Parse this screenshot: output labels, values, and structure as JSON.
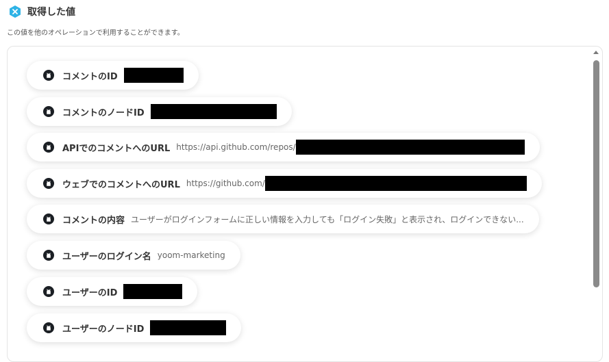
{
  "header": {
    "title": "取得した値",
    "description": "この値を他のオペレーションで利用することができます。"
  },
  "fields": [
    {
      "label": "コメントのID",
      "value": ""
    },
    {
      "label": "コメントのノードID",
      "value": ""
    },
    {
      "label": "APIでのコメントへのURL",
      "value": "https://api.github.com/repos/"
    },
    {
      "label": "ウェブでのコメントへのURL",
      "value": "https://github.com/"
    },
    {
      "label": "コメントの内容",
      "value": "ユーザーがログインフォームに正しい情報を入力しても「ログイン失敗」と表示され、ログインできない..."
    },
    {
      "label": "ユーザーのログイン名",
      "value": "yoom-marketing"
    },
    {
      "label": "ユーザーのID",
      "value": ""
    },
    {
      "label": "ユーザーのノードID",
      "value": ""
    }
  ],
  "icons": {
    "header": "yoom-logo-icon",
    "field": "github-icon"
  },
  "colors": {
    "logo": "#2fb3e6",
    "github_icon_bg": "#1b1f24",
    "redaction": "#000000",
    "scrollbar": "#8a8a8a"
  }
}
